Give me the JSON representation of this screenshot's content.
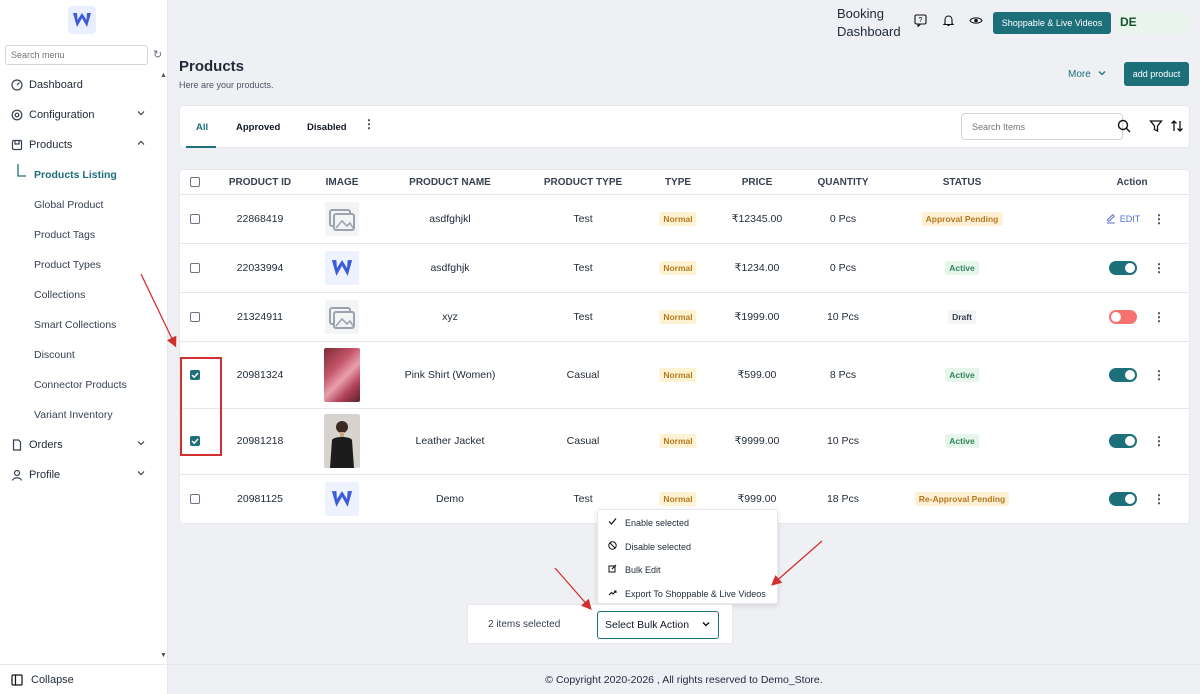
{
  "sidebar": {
    "search_placeholder": "Search menu",
    "items": [
      {
        "label": "Dashboard",
        "icon": "dashboard-icon"
      },
      {
        "label": "Configuration",
        "icon": "settings-icon"
      },
      {
        "label": "Products",
        "icon": "products-icon"
      },
      {
        "label": "Orders",
        "icon": "orders-icon"
      },
      {
        "label": "Profile",
        "icon": "profile-icon"
      }
    ],
    "product_subitems": [
      "Products Listing",
      "Global Product",
      "Product Tags",
      "Product Types",
      "Collections",
      "Smart Collections",
      "Discount",
      "Connector Products",
      "Variant Inventory"
    ],
    "collapse_label": "Collapse"
  },
  "header": {
    "booking_line1": "Booking",
    "booking_line2": "Dashboard",
    "shoppable_label": "Shoppable & Live Videos",
    "avatar_initials": "DE"
  },
  "page": {
    "title": "Products",
    "subtitle": "Here are your products.",
    "more_label": "More",
    "add_label": "add product"
  },
  "tabs": [
    "All",
    "Approved",
    "Disabled"
  ],
  "search": {
    "placeholder": "Search Items"
  },
  "table": {
    "headers": [
      "PRODUCT ID",
      "IMAGE",
      "PRODUCT NAME",
      "PRODUCT TYPE",
      "TYPE",
      "PRICE",
      "QUANTITY",
      "STATUS",
      "Action"
    ],
    "rows": [
      {
        "id": "22868419",
        "image": "placeholder",
        "name": "asdfghjkl",
        "ptype": "Test",
        "type": "Normal",
        "price": "₹12345.00",
        "qty": "0 Pcs",
        "status": "Approval Pending",
        "checked": false,
        "action": "edit",
        "action_label": "EDIT"
      },
      {
        "id": "22033994",
        "image": "logo",
        "name": "asdfghjk",
        "ptype": "Test",
        "type": "Normal",
        "price": "₹1234.00",
        "qty": "0 Pcs",
        "status": "Active",
        "checked": false,
        "action": "toggle-on"
      },
      {
        "id": "21324911",
        "image": "placeholder",
        "name": "xyz",
        "ptype": "Test",
        "type": "Normal",
        "price": "₹1999.00",
        "qty": "10 Pcs",
        "status": "Draft",
        "checked": false,
        "action": "toggle-off"
      },
      {
        "id": "20981324",
        "image": "photo-shirt",
        "name": "Pink Shirt (Women)",
        "ptype": "Casual",
        "type": "Normal",
        "price": "₹599.00",
        "qty": "8 Pcs",
        "status": "Active",
        "checked": true,
        "action": "toggle-on"
      },
      {
        "id": "20981218",
        "image": "photo-jacket",
        "name": "Leather Jacket",
        "ptype": "Casual",
        "type": "Normal",
        "price": "₹9999.00",
        "qty": "10 Pcs",
        "status": "Active",
        "checked": true,
        "action": "toggle-on"
      },
      {
        "id": "20981125",
        "image": "logo",
        "name": "Demo",
        "ptype": "Test",
        "type": "Normal",
        "price": "₹999.00",
        "qty": "18 Pcs",
        "status": "Re-Approval Pending",
        "checked": false,
        "action": "toggle-on"
      }
    ]
  },
  "bulk_menu": [
    "Enable selected",
    "Disable selected",
    "Bulk Edit",
    "Export To Shoppable & Live Videos"
  ],
  "bulk_bar": {
    "count_label": "2 items selected",
    "select_label": "Select Bulk Action"
  },
  "footer": {
    "text": "© Copyright 2020-2026 , All rights reserved to Demo_Store."
  },
  "colors": {
    "accent": "#1d6f7a",
    "annotation": "#d32f2f"
  }
}
